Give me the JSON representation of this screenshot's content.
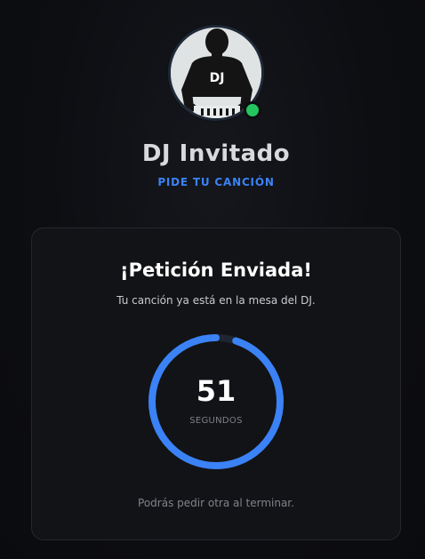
{
  "profile": {
    "avatar_icon": "dj-silhouette-icon",
    "avatar_badge_text": "DJ",
    "online_status_color": "#22c55e",
    "name": "DJ Invitado",
    "subtitle": "PIDE TU CANCIÓN"
  },
  "confirmation": {
    "title": "¡Petición Enviada!",
    "message": "Tu canción ya está en la mesa del DJ.",
    "countdown": {
      "value": "51",
      "unit_label": "SEGUNDOS",
      "progress_fraction": 0.95,
      "track_color": "#1e2533",
      "progress_color": "#3b82f6"
    },
    "note": "Podrás pedir otra al terminar."
  },
  "colors": {
    "accent": "#3b82f6",
    "background": "#0d0e12",
    "card_background": "#121316"
  }
}
